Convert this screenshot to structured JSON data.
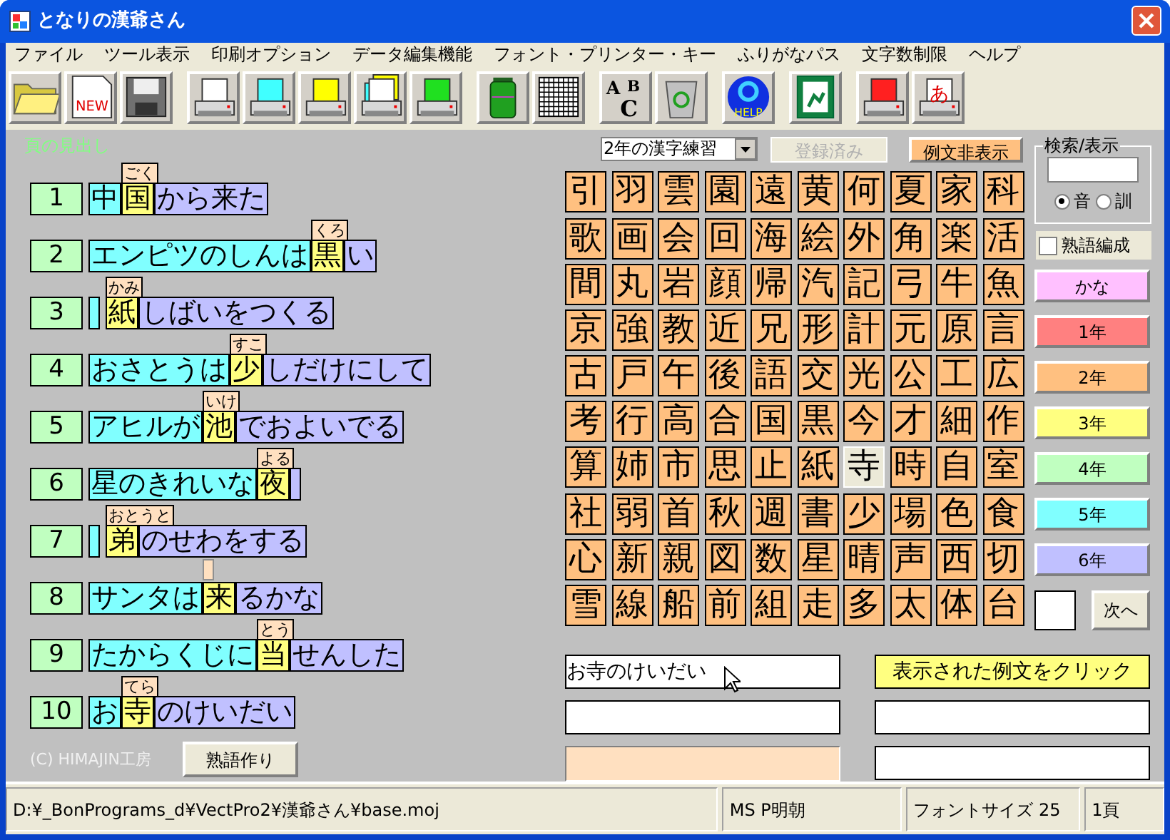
{
  "window": {
    "title": "となりの漢爺さん"
  },
  "menu": [
    "ファイル",
    "ツール表示",
    "印刷オプション",
    "データ編集機能",
    "フォント・プリンター・キー",
    "ふりがなパス",
    "文字数制限",
    "ヘルプ"
  ],
  "toolbar_groups": [
    [
      {
        "kind": "open"
      },
      {
        "kind": "new",
        "text": "NEW"
      },
      {
        "kind": "save"
      }
    ],
    [
      {
        "kind": "printer",
        "color": "#ffffff"
      },
      {
        "kind": "printer",
        "color": "#40ffff"
      },
      {
        "kind": "printer",
        "color": "#ffff00"
      },
      {
        "kind": "printer-stack"
      },
      {
        "kind": "printer",
        "color": "#20e020"
      }
    ],
    [
      {
        "kind": "battery"
      },
      {
        "kind": "grid"
      }
    ],
    [
      {
        "kind": "abc",
        "letters": [
          "A",
          "B",
          "C"
        ]
      },
      {
        "kind": "recycle"
      }
    ],
    [
      {
        "kind": "help",
        "text": "HELP"
      }
    ],
    [
      {
        "kind": "exit"
      }
    ],
    [
      {
        "kind": "printer",
        "color": "#ff2020"
      },
      {
        "kind": "printer-glyph",
        "color": "#ffffff",
        "text": "あ"
      }
    ]
  ],
  "page_heading": "頁の見出し",
  "sentences": [
    {
      "number": "1",
      "before": "中",
      "kanji": "国",
      "reading": "ごく",
      "after": "から来た"
    },
    {
      "number": "2",
      "before": "エンピツのしんは",
      "kanji": "黒",
      "reading": "くろ",
      "after": "い"
    },
    {
      "number": "3",
      "kanji": "紙",
      "reading": "かみ",
      "after": "しばいをつくる"
    },
    {
      "number": "4",
      "before": "おさとうは",
      "kanji": "少",
      "reading": "すこ",
      "after": "しだけにして"
    },
    {
      "number": "5",
      "before": "アヒルが",
      "kanji": "池",
      "reading": "いけ",
      "after": "でおよいでる"
    },
    {
      "number": "6",
      "before": "星のきれいな",
      "kanji": "夜",
      "reading": "よる"
    },
    {
      "number": "7",
      "kanji": "弟",
      "reading": "おとうと",
      "after": "のせわをする"
    },
    {
      "number": "8",
      "before": "サンタは",
      "kanji": "来",
      "after": "るかな"
    },
    {
      "number": "9",
      "before": "たからくじに",
      "kanji": "当",
      "reading": "とう",
      "after": "せんした"
    },
    {
      "number": "10",
      "before": "お",
      "kanji": "寺",
      "reading": "てら",
      "after": "のけいだい"
    }
  ],
  "copyright": "(C) HIMAJIN工房",
  "compound_button": "熟語作り",
  "set_select": {
    "value": "2年の漢字練習"
  },
  "register_button": {
    "label": "登録済み",
    "disabled": true
  },
  "hide_examples_button": "例文非表示",
  "kanji_rows": [
    [
      {
        "char": "引",
        "selected": false
      },
      {
        "char": "羽",
        "selected": false
      },
      {
        "char": "雲",
        "selected": false
      },
      {
        "char": "園",
        "selected": false
      },
      {
        "char": "遠",
        "selected": false
      },
      {
        "char": "黄",
        "selected": false
      },
      {
        "char": "何",
        "selected": false
      },
      {
        "char": "夏",
        "selected": false
      },
      {
        "char": "家",
        "selected": false
      },
      {
        "char": "科",
        "selected": false
      }
    ],
    [
      {
        "char": "歌",
        "selected": false
      },
      {
        "char": "画",
        "selected": false
      },
      {
        "char": "会",
        "selected": false
      },
      {
        "char": "回",
        "selected": false
      },
      {
        "char": "海",
        "selected": false
      },
      {
        "char": "絵",
        "selected": false
      },
      {
        "char": "外",
        "selected": false
      },
      {
        "char": "角",
        "selected": false
      },
      {
        "char": "楽",
        "selected": false
      },
      {
        "char": "活",
        "selected": false
      }
    ],
    [
      {
        "char": "間",
        "selected": false
      },
      {
        "char": "丸",
        "selected": false
      },
      {
        "char": "岩",
        "selected": false
      },
      {
        "char": "顔",
        "selected": false
      },
      {
        "char": "帰",
        "selected": false
      },
      {
        "char": "汽",
        "selected": false
      },
      {
        "char": "記",
        "selected": false
      },
      {
        "char": "弓",
        "selected": false
      },
      {
        "char": "牛",
        "selected": false
      },
      {
        "char": "魚",
        "selected": false
      }
    ],
    [
      {
        "char": "京",
        "selected": false
      },
      {
        "char": "強",
        "selected": false
      },
      {
        "char": "教",
        "selected": false
      },
      {
        "char": "近",
        "selected": false
      },
      {
        "char": "兄",
        "selected": false
      },
      {
        "char": "形",
        "selected": false
      },
      {
        "char": "計",
        "selected": false
      },
      {
        "char": "元",
        "selected": false
      },
      {
        "char": "原",
        "selected": false
      },
      {
        "char": "言",
        "selected": false
      }
    ],
    [
      {
        "char": "古",
        "selected": false
      },
      {
        "char": "戸",
        "selected": false
      },
      {
        "char": "午",
        "selected": false
      },
      {
        "char": "後",
        "selected": false
      },
      {
        "char": "語",
        "selected": false
      },
      {
        "char": "交",
        "selected": false
      },
      {
        "char": "光",
        "selected": false
      },
      {
        "char": "公",
        "selected": false
      },
      {
        "char": "工",
        "selected": false
      },
      {
        "char": "広",
        "selected": false
      }
    ],
    [
      {
        "char": "考",
        "selected": false
      },
      {
        "char": "行",
        "selected": false
      },
      {
        "char": "高",
        "selected": false
      },
      {
        "char": "合",
        "selected": false
      },
      {
        "char": "国",
        "selected": false
      },
      {
        "char": "黒",
        "selected": false
      },
      {
        "char": "今",
        "selected": false
      },
      {
        "char": "才",
        "selected": false
      },
      {
        "char": "細",
        "selected": false
      },
      {
        "char": "作",
        "selected": false
      }
    ],
    [
      {
        "char": "算",
        "selected": false
      },
      {
        "char": "姉",
        "selected": false
      },
      {
        "char": "市",
        "selected": false
      },
      {
        "char": "思",
        "selected": false
      },
      {
        "char": "止",
        "selected": false
      },
      {
        "char": "紙",
        "selected": false
      },
      {
        "char": "寺",
        "selected": true
      },
      {
        "char": "時",
        "selected": false
      },
      {
        "char": "自",
        "selected": false
      },
      {
        "char": "室",
        "selected": false
      }
    ],
    [
      {
        "char": "社",
        "selected": false
      },
      {
        "char": "弱",
        "selected": false
      },
      {
        "char": "首",
        "selected": false
      },
      {
        "char": "秋",
        "selected": false
      },
      {
        "char": "週",
        "selected": false
      },
      {
        "char": "書",
        "selected": false
      },
      {
        "char": "少",
        "selected": false
      },
      {
        "char": "場",
        "selected": false
      },
      {
        "char": "色",
        "selected": false
      },
      {
        "char": "食",
        "selected": false
      }
    ],
    [
      {
        "char": "心",
        "selected": false
      },
      {
        "char": "新",
        "selected": false
      },
      {
        "char": "親",
        "selected": false
      },
      {
        "char": "図",
        "selected": false
      },
      {
        "char": "数",
        "selected": false
      },
      {
        "char": "星",
        "selected": false
      },
      {
        "char": "晴",
        "selected": false
      },
      {
        "char": "声",
        "selected": false
      },
      {
        "char": "西",
        "selected": false
      },
      {
        "char": "切",
        "selected": false
      }
    ],
    [
      {
        "char": "雪",
        "selected": false
      },
      {
        "char": "線",
        "selected": false
      },
      {
        "char": "船",
        "selected": false
      },
      {
        "char": "前",
        "selected": false
      },
      {
        "char": "組",
        "selected": false
      },
      {
        "char": "走",
        "selected": false
      },
      {
        "char": "多",
        "selected": false
      },
      {
        "char": "太",
        "selected": false
      },
      {
        "char": "体",
        "selected": false
      },
      {
        "char": "台",
        "selected": false
      }
    ]
  ],
  "search": {
    "title": "検索/表示",
    "radios": [
      {
        "label": "音",
        "selected": true
      },
      {
        "label": "訓",
        "selected": false
      }
    ]
  },
  "compound_checkbox": {
    "label": "熟語編成",
    "checked": false
  },
  "grade_buttons": [
    {
      "label": "かな",
      "color": "#ffc0ff"
    },
    {
      "label": "1年",
      "color": "#ff8080"
    },
    {
      "label": "2年",
      "color": "#ffc080"
    },
    {
      "label": "3年",
      "color": "#ffff80"
    },
    {
      "label": "4年",
      "color": "#c0ffc0"
    },
    {
      "label": "5年",
      "color": "#80ffff"
    },
    {
      "label": "6年",
      "color": "#c0c0ff"
    }
  ],
  "next_button": "次へ",
  "left_fields": [
    {
      "kind": "text",
      "value": "お寺のけいだい"
    },
    {
      "kind": "text"
    },
    {
      "kind": "answer"
    }
  ],
  "right_fields": [
    {
      "kind": "hint",
      "text": "表示された例文をクリック"
    },
    {
      "kind": "text"
    },
    {
      "kind": "text"
    }
  ],
  "status_bar": [
    "D:¥_BonPrograms_d¥VectPro2¥漢爺さん¥base.moj",
    "MS P明朝",
    "フォントサイズ 25",
    "1頁"
  ]
}
